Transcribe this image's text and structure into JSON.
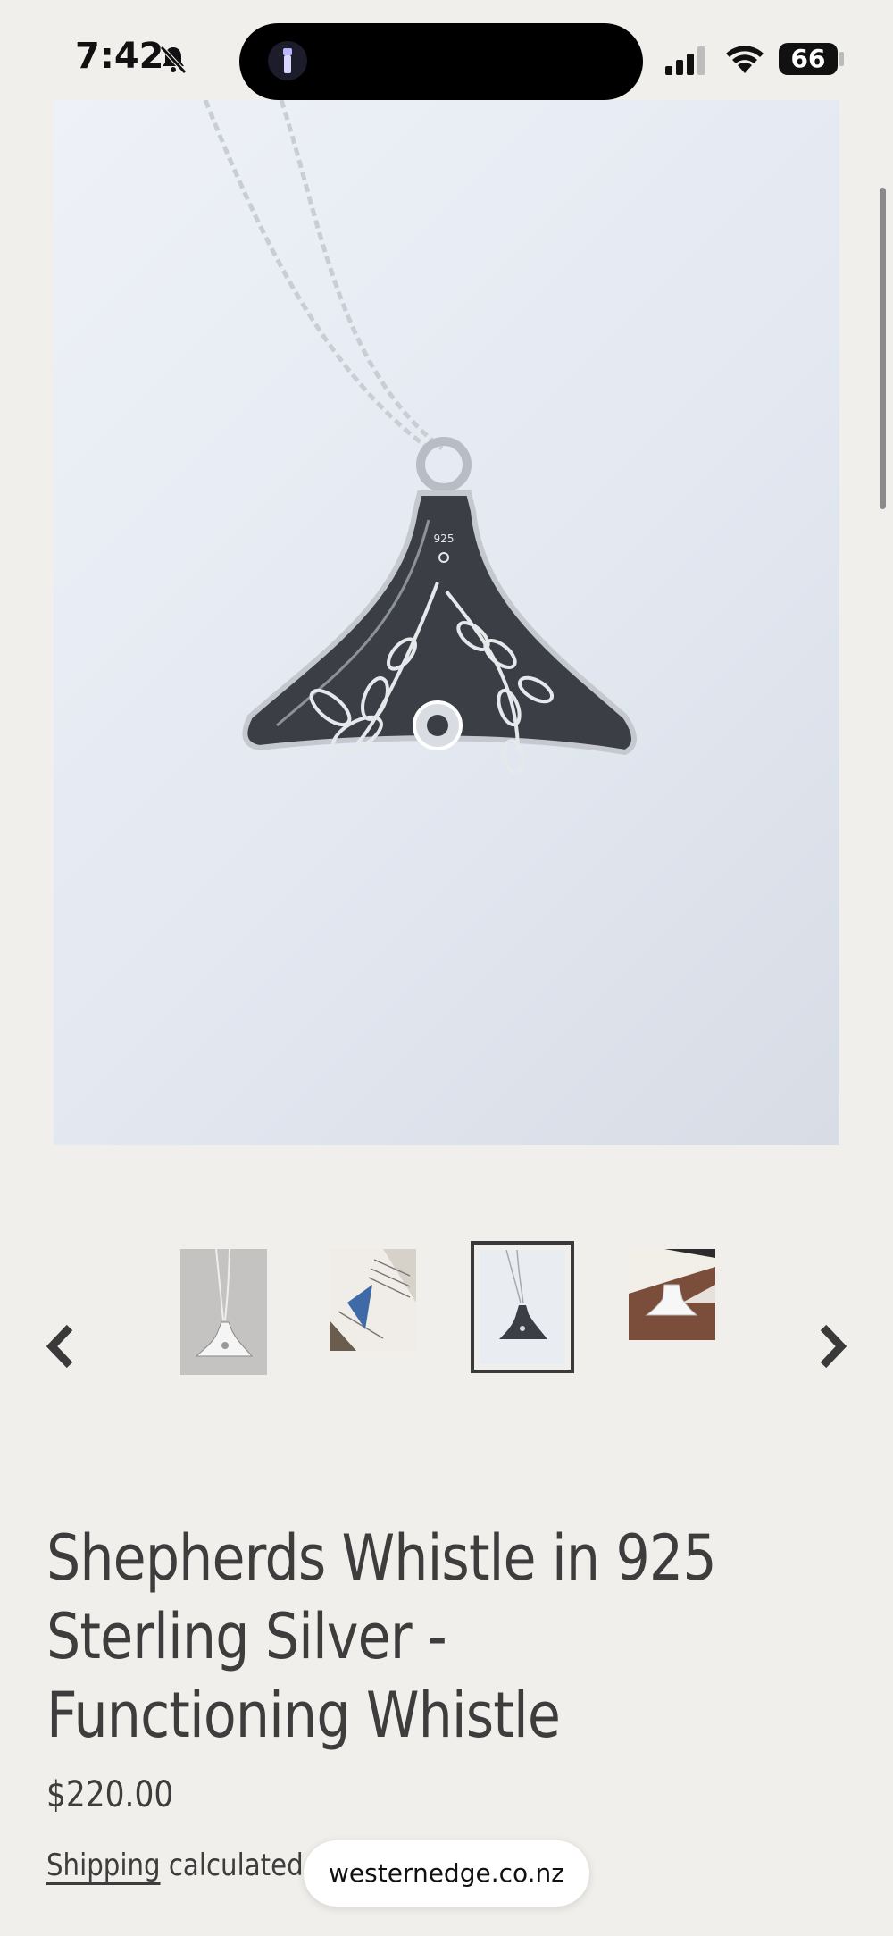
{
  "status_bar": {
    "time": "7:42",
    "battery": "66"
  },
  "gallery": {
    "main_image_alt": "Shepherds Whistle pendant on silver chain",
    "engraving_mark": "925",
    "thumbnails_count_visible": 4,
    "selected_thumbnail": 3
  },
  "product": {
    "title": "Shepherds Whistle in 925 Sterling Silver - Functioning Whistle",
    "price": "$220.00",
    "shipping_link": "Shipping",
    "shipping_rest": " calculated at"
  },
  "browser": {
    "url": "westernedge.co.nz"
  },
  "colors": {
    "background": "#f1efeb",
    "text": "#3d3d3d"
  }
}
